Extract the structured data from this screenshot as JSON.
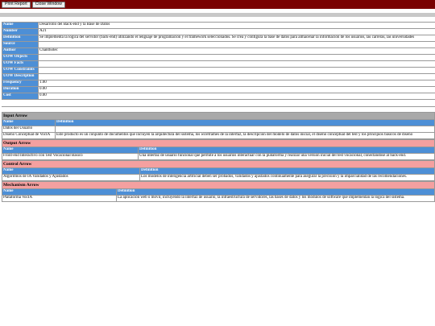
{
  "toolbar": {
    "print_label": "Print Report",
    "close_label": "Close Window"
  },
  "colors": {
    "topbar": "#7a0000",
    "label_bg": "#4d8fd6",
    "input_header": "#a9a9a9",
    "other_header": "#f4a0a0"
  },
  "meta": [
    {
      "label": "Name",
      "value": "Desarrollo del  Back-end y la  Base de Datos"
    },
    {
      "label": "Number",
      "value": "A21"
    },
    {
      "label": "Definition",
      "value": "Se implementa la lógica del servidor (back-end) utilizando el lenguaje de programación y el framework seleccionados. Se crea y configura la base de datos para almacenar la información de los usuarios, las carreras, las universidades"
    },
    {
      "label": "Source",
      "value": ""
    },
    {
      "label": "Author",
      "value": "Chanthotec"
    },
    {
      "label": "UOW Objects",
      "value": ""
    },
    {
      "label": "UOW Facts",
      "value": ""
    },
    {
      "label": "UOW Constraints",
      "value": ""
    },
    {
      "label": "UOW Description",
      "value": ""
    },
    {
      "label": "Frequency",
      "value": "1.00"
    },
    {
      "label": "Duration",
      "value": "0.00"
    },
    {
      "label": "Cost",
      "value": "0.00"
    }
  ],
  "input_arrow": {
    "title": "Input Arrow",
    "col_name": "Name",
    "col_def": "Definition",
    "rows": [
      {
        "name": "Datos del Usuario",
        "def": ""
      },
      {
        "name": "Diseño Conceptual de VocIA",
        "def": "Este producto es un conjunto de documentos que incluyen la arquitectura del sistema, los wireframes de la interfaz, la descripción del modelo de datos inicial, el diseño conceptual del test y los principios básicos de diseño"
      }
    ]
  },
  "output_arrow": {
    "title": "Output Arrow",
    "col_name": "Name",
    "col_def": "Definition",
    "rows": [
      {
        "name": "Front-end Interactivo con Test Vocacional Básico",
        "def": "Una interfaz de usuario funcional que permite a los usuarios interactuar con la plataforma y realizar una versión inicial del test vocacional, conectándose al back-end."
      }
    ]
  },
  "control_arrow": {
    "title": "Control Arrow",
    "col_name": "Name",
    "col_def": "Definition",
    "rows": [
      {
        "name": "Algoritmos de IA Validados y Ajustados",
        "def": "Los modelos de inteligencia artificial deben ser probados, validados y ajustados continuamente para asegurar la precisión y la imparcialidad de las recomendaciones."
      }
    ]
  },
  "mechanism_arrow": {
    "title": "Mechanism Arrow",
    "col_name": "Name",
    "col_def": "Definition",
    "rows": [
      {
        "name": "Plataforma VocIA",
        "def": "La aplicación web o móvil, incluyendo la interfaz de usuario, la infraestructura de servidores, las bases de datos y los módulos de software que implementan la lógica del sistema."
      }
    ]
  }
}
